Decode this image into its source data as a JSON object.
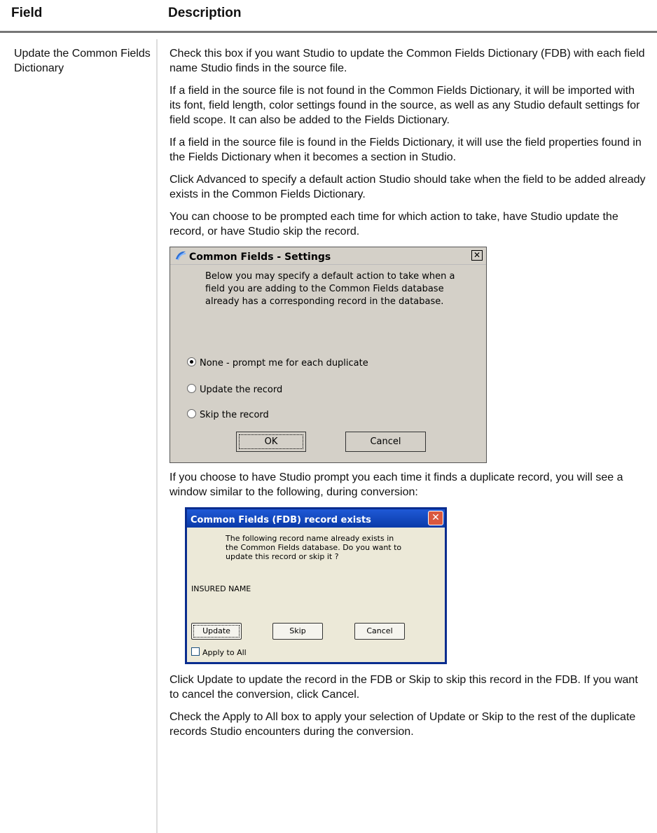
{
  "table": {
    "header_field": "Field",
    "header_description": "Description",
    "row_field": "Update the Common Fields Dictionary"
  },
  "paragraphs": [
    "Check this box if you want Studio to update the Common Fields Dictionary (FDB) with each field name Studio finds in the source file.",
    "If a field in the source file is not found in the Common Fields Dictionary, it will be imported with its font, field length, color settings found in the source, as well as any Studio default settings for field scope. It can also be added to the Fields Dictionary.",
    "If a field in the source file is found in the Fields Dictionary, it will use the field properties found in the Fields Dictionary when it becomes a section in Studio.",
    "Click Advanced to specify a default action Studio should take when the field to be added already exists in the Common Fields Dictionary.",
    "You can choose to be prompted each time for which action to take, have Studio update the record, or have Studio skip the record.",
    "If you choose to have Studio prompt you each time it finds a duplicate record, you will see a window similar to the following, during conversion:",
    "Click Update to update the record in the FDB or Skip to skip this record in the FDB. If you want to cancel the conversion, click Cancel.",
    "Check the Apply to All box to apply your selection of Update or Skip to the rest of the duplicate records Studio encounters during the conversion."
  ],
  "dialog_settings": {
    "title": "Common Fields - Settings",
    "message": "Below you may specify a default action to take when a field you are adding to the Common Fields database already has a corresponding record in the database.",
    "options": [
      "None - prompt me for each duplicate",
      "Update the record",
      "Skip the record"
    ],
    "selected_option": 0,
    "ok_label": "OK",
    "cancel_label": "Cancel",
    "close_glyph": "✕"
  },
  "dialog_exists": {
    "title": "Common Fields (FDB) record exists",
    "message": "The following record name already exists in the Common Fields database.  Do you want to update this record or skip it ?",
    "record_name": "INSURED NAME",
    "update_label": "Update",
    "skip_label": "Skip",
    "cancel_label": "Cancel",
    "apply_all_label": "Apply to All",
    "apply_all_checked": false,
    "close_glyph": "✕"
  }
}
